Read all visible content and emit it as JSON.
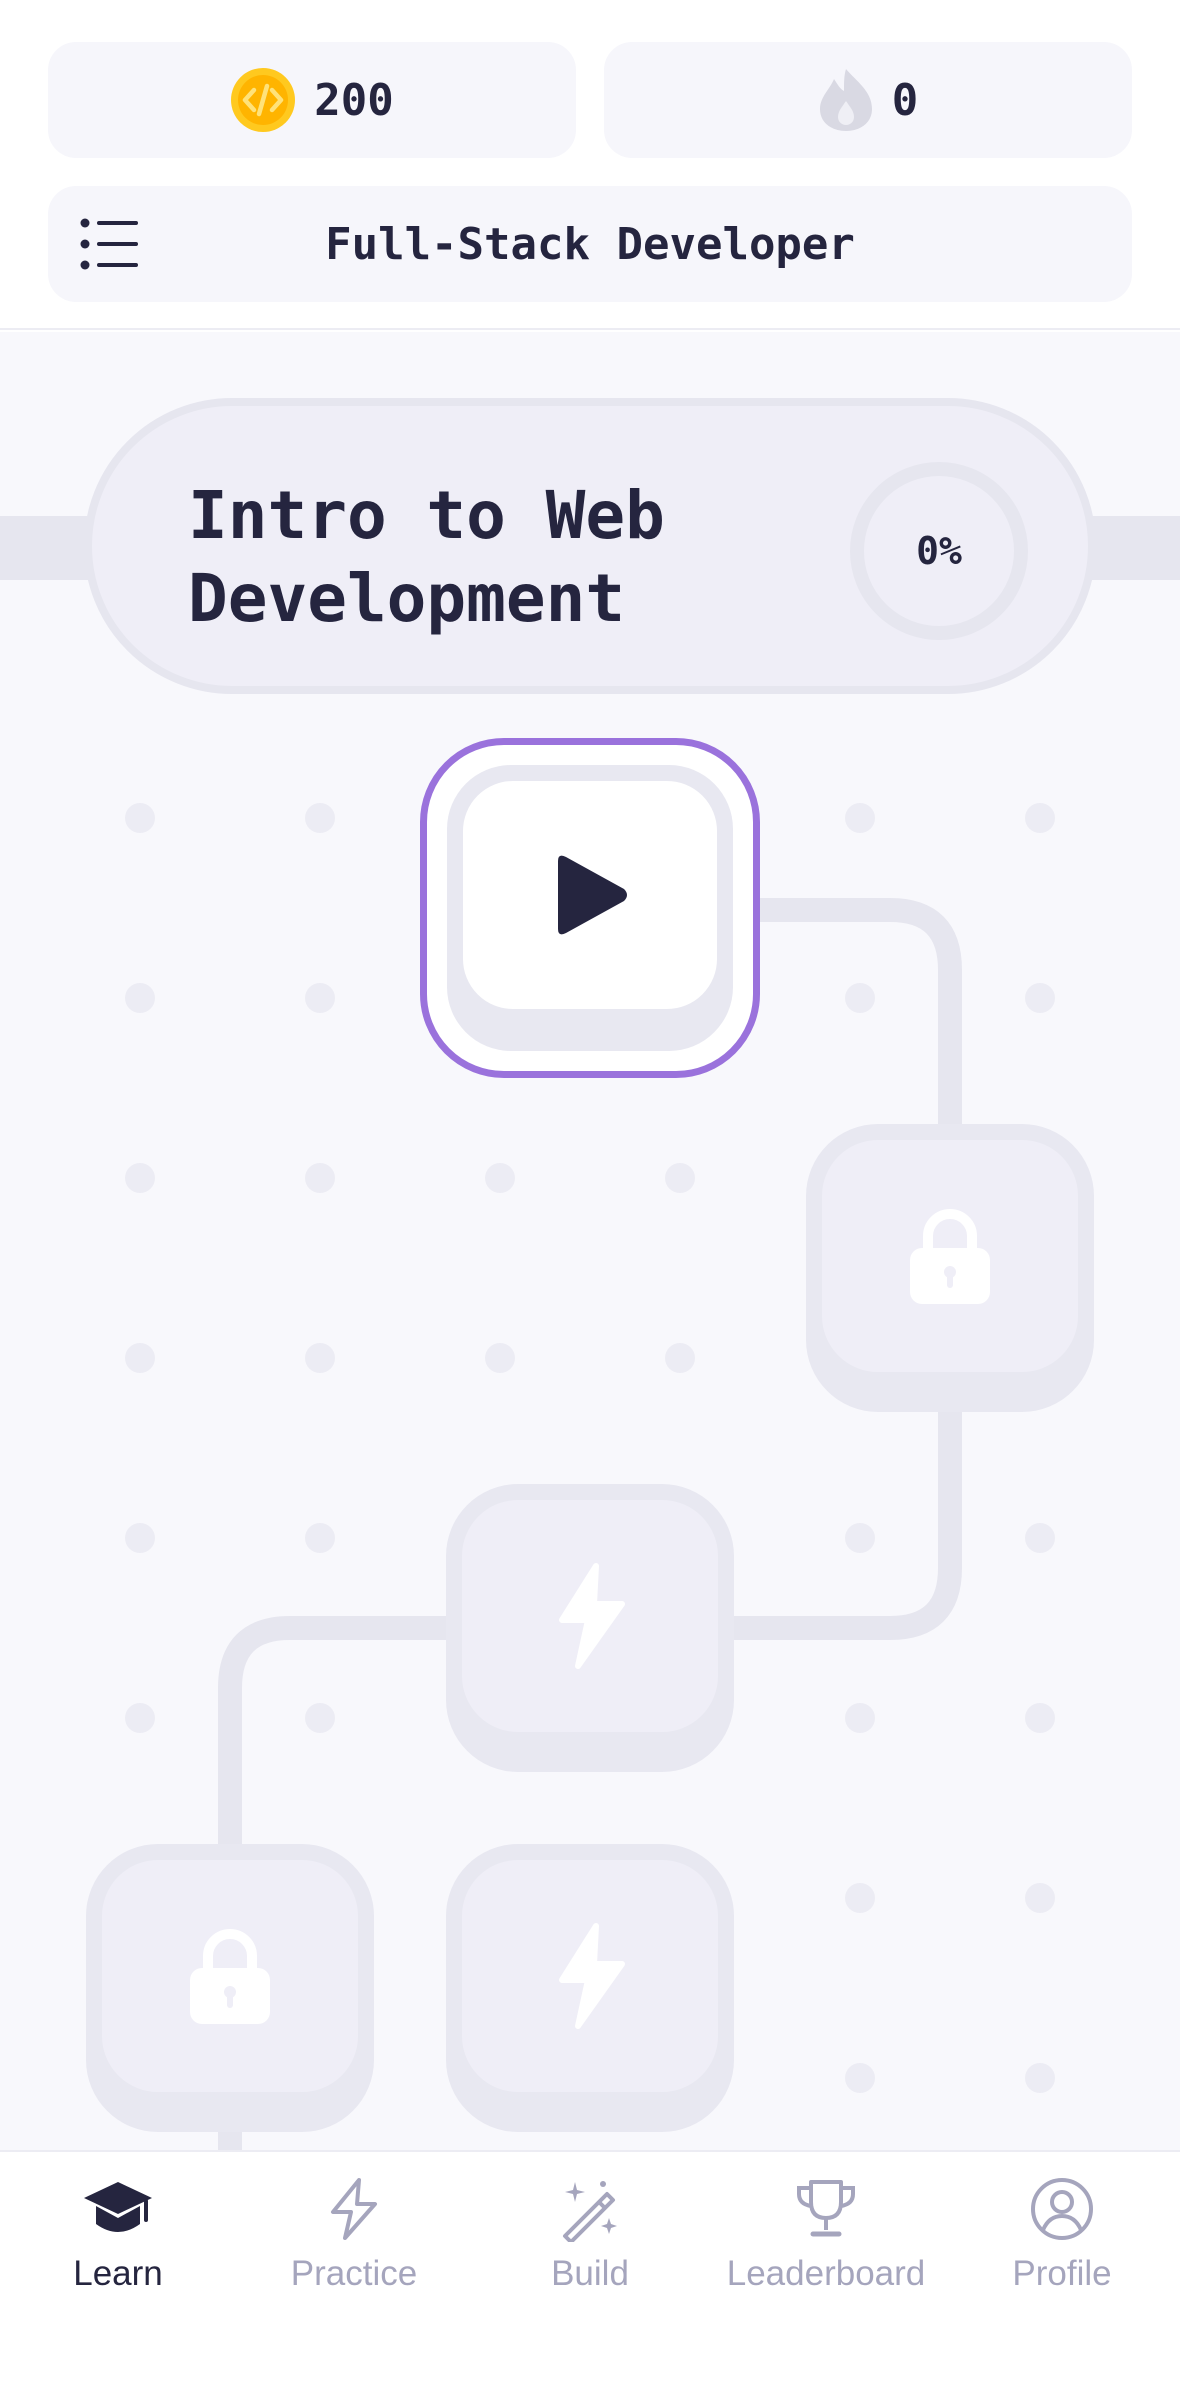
{
  "header": {
    "coins": "200",
    "streak": "0",
    "course_title": "Full-Stack Developer"
  },
  "unit": {
    "title_line1": "Intro to Web",
    "title_line2": "Development",
    "progress": "0%"
  },
  "path": {
    "nodes": [
      {
        "type": "play",
        "state": "current"
      },
      {
        "type": "lock",
        "state": "locked"
      },
      {
        "type": "bolt",
        "state": "locked"
      },
      {
        "type": "lock",
        "state": "locked"
      },
      {
        "type": "bolt",
        "state": "locked"
      }
    ]
  },
  "nav": {
    "items": [
      {
        "label": "Learn",
        "icon": "graduation-cap-icon",
        "active": true
      },
      {
        "label": "Practice",
        "icon": "lightning-icon",
        "active": false
      },
      {
        "label": "Build",
        "icon": "magic-wand-icon",
        "active": false
      },
      {
        "label": "Leaderboard",
        "icon": "trophy-icon",
        "active": false
      },
      {
        "label": "Profile",
        "icon": "user-circle-icon",
        "active": false
      }
    ]
  },
  "colors": {
    "accent": "#9a72dc",
    "text": "#25253f",
    "coin": "#ffc91f",
    "muted": "#a5a5bd",
    "canvas": "#f8f8fc"
  }
}
